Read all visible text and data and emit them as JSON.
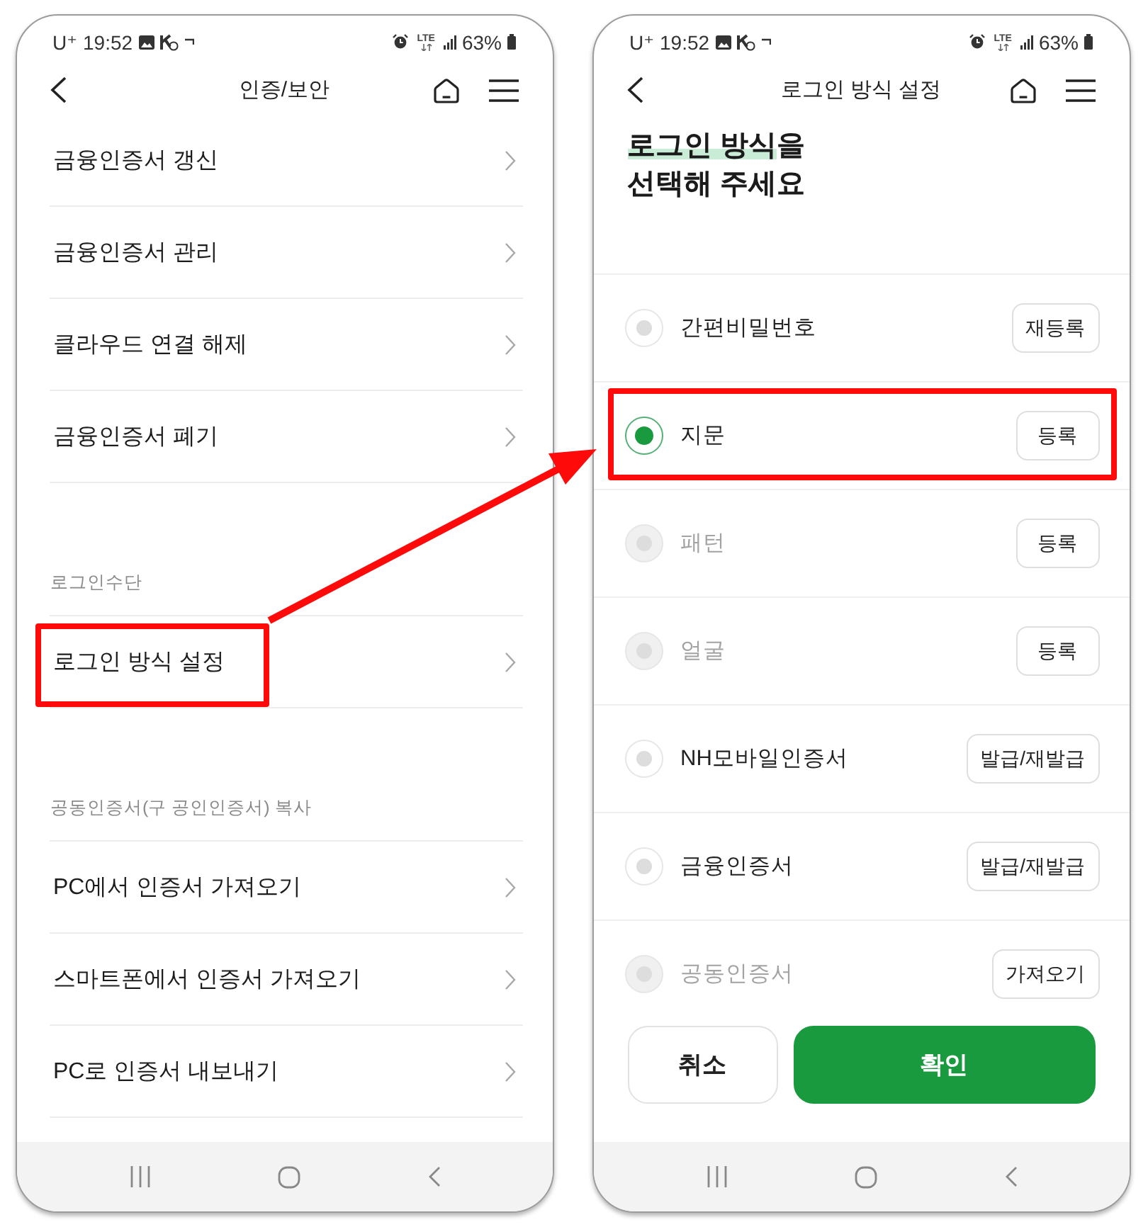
{
  "menu_screen": {
    "status_bar": {
      "carrier": "U⁺",
      "time": "19:52",
      "network": "LTE",
      "battery": "63%"
    },
    "header": {
      "title": "인증/보안"
    },
    "sections": [
      {
        "items": [
          {
            "label": "금융인증서 갱신",
            "highlighted": false
          },
          {
            "label": "금융인증서 관리",
            "highlighted": false
          },
          {
            "label": "클라우드 연결 해제",
            "highlighted": false
          },
          {
            "label": "금융인증서 폐기",
            "highlighted": false
          }
        ]
      },
      {
        "label": "로그인수단",
        "items": [
          {
            "label": "로그인 방식 설정",
            "highlighted": true
          }
        ]
      },
      {
        "label": "공동인증서(구 공인인증서) 복사",
        "items": [
          {
            "label": "PC에서 인증서 가져오기",
            "highlighted": false
          },
          {
            "label": "스마트폰에서 인증서 가져오기",
            "highlighted": false
          },
          {
            "label": "PC로 인증서 내보내기",
            "highlighted": false
          }
        ]
      }
    ]
  },
  "login_method_screen": {
    "status_bar": {
      "carrier": "U⁺",
      "time": "19:52",
      "network": "LTE",
      "battery": "63%"
    },
    "header": {
      "title": "로그인 방식 설정"
    },
    "heading": [
      [
        {
          "text": "로그인 방식",
          "marked": true
        },
        {
          "text": "을",
          "marked": false
        }
      ],
      [
        {
          "text": "선택해 주세요",
          "marked": false
        }
      ]
    ],
    "options": [
      {
        "label": "간편비밀번호",
        "selected": false,
        "disabled": false,
        "button": "재등록",
        "highlighted": false
      },
      {
        "label": "지문",
        "selected": true,
        "disabled": false,
        "button": "등록",
        "highlighted": true
      },
      {
        "label": "패턴",
        "selected": false,
        "disabled": true,
        "button": "등록",
        "highlighted": false
      },
      {
        "label": "얼굴",
        "selected": false,
        "disabled": true,
        "button": "등록",
        "highlighted": false
      },
      {
        "label": "NH모바일인증서",
        "selected": false,
        "disabled": false,
        "button": "발급/재발급",
        "highlighted": false
      },
      {
        "label": "금융인증서",
        "selected": false,
        "disabled": false,
        "button": "발급/재발급",
        "highlighted": false
      },
      {
        "label": "공동인증서",
        "selected": false,
        "disabled": true,
        "button": "가져오기",
        "highlighted": false
      }
    ],
    "actions": [
      {
        "label": "취소",
        "kind": "secondary"
      },
      {
        "label": "확인",
        "kind": "primary"
      }
    ]
  }
}
